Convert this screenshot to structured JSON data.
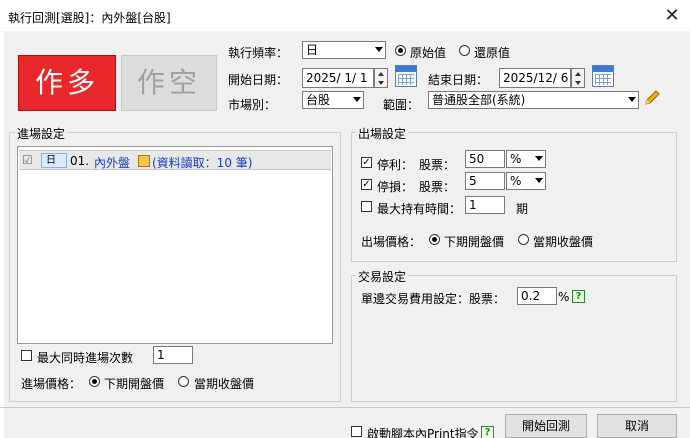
{
  "window": {
    "title": "執行回測[選股]：內外盤[台股]",
    "close_glyph": "✕"
  },
  "direction": {
    "long_label": "作多",
    "short_label": "作空"
  },
  "settings": {
    "freq_label": "執行頻率：",
    "freq_value": "日",
    "value_type_original": "原始值",
    "value_type_restored": "還原值",
    "start_label": "開始日期：",
    "start_value": "2025/ 1/ 1",
    "end_label": "結束日期：",
    "end_value": "2025/12/ 6",
    "market_label": "市場別：",
    "market_value": "台股",
    "range_label": "範圍：",
    "range_value": "普通股全部(系統)"
  },
  "entry": {
    "group_title": "進場設定",
    "row_check": "☑",
    "row_freq": "日",
    "row_index": "01.",
    "row_name": "內外盤",
    "row_info": "(資料讀取：10 筆)",
    "max_entries_label": "最大同時進場次數",
    "max_entries_value": "1",
    "price_label": "進場價格：",
    "price_next_open": "下期開盤價",
    "price_current_close": "當期收盤價"
  },
  "exit": {
    "group_title": "出場設定",
    "take_profit_label": "停利：",
    "take_profit_stock_label": "股票：",
    "take_profit_value": "50",
    "take_profit_unit": "%",
    "stop_loss_label": "停損：",
    "stop_loss_stock_label": "股票：",
    "stop_loss_value": "5",
    "stop_loss_unit": "%",
    "max_hold_label": "最大持有時間：",
    "max_hold_value": "1",
    "max_hold_unit": "期",
    "price_label": "出場價格：",
    "price_next_open": "下期開盤價",
    "price_current_close": "當期收盤價"
  },
  "trade": {
    "group_title": "交易設定",
    "fee_label": "單邊交易費用設定：股票：",
    "fee_value": "0.2",
    "fee_unit": "%",
    "help": "?"
  },
  "footer": {
    "print_label": "啟動腳本內Print指令",
    "help": "?",
    "start_button": "開始回測",
    "cancel_button": "取消"
  }
}
